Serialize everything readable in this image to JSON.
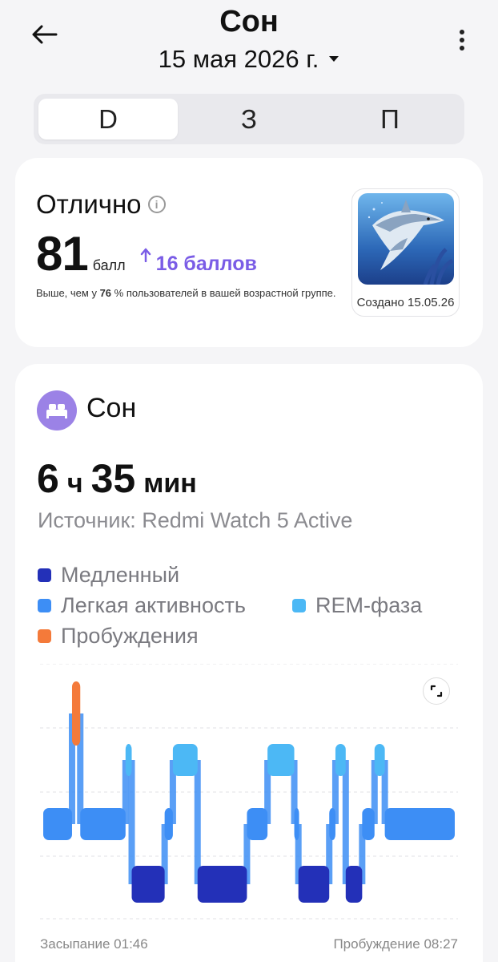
{
  "header": {
    "title": "Сон",
    "date": "15 мая 2026 г."
  },
  "tabs": [
    {
      "label": "D",
      "active": true
    },
    {
      "label": "З",
      "active": false
    },
    {
      "label": "П",
      "active": false
    }
  ],
  "score_card": {
    "rating": "Отлично",
    "score": "81",
    "score_unit": "балл",
    "delta": "16 баллов",
    "compare_prefix": "Выше, чем у ",
    "compare_value": "76",
    "compare_suffix": " % пользователей в вашей возрастной группе.",
    "badge_caption": "Создано 15.05.26"
  },
  "sleep": {
    "title": "Сон",
    "hours": "6",
    "hours_unit": "ч",
    "minutes": "35",
    "minutes_unit": "мин",
    "source": "Источник: Redmi Watch 5 Active",
    "legend": {
      "deep": "Медленный",
      "light": "Легкая активность",
      "rem": "REM-фаза",
      "awake": "Пробуждения"
    },
    "colors": {
      "deep": "#2330b8",
      "light": "#3d8ef5",
      "rem": "#4cb8f5",
      "awake": "#f47a3a"
    },
    "sleep_start_label": "Засыпание 01:46",
    "wake_label": "Пробуждение 08:27"
  },
  "chart_data": {
    "type": "timeline",
    "stages": [
      "awake",
      "rem",
      "light",
      "deep"
    ],
    "start": "01:46",
    "end": "08:27",
    "segments": [
      {
        "stage": "light",
        "from": 0.0,
        "to": 0.07
      },
      {
        "stage": "awake",
        "from": 0.07,
        "to": 0.09
      },
      {
        "stage": "light",
        "from": 0.09,
        "to": 0.2
      },
      {
        "stage": "rem",
        "from": 0.2,
        "to": 0.215
      },
      {
        "stage": "deep",
        "from": 0.215,
        "to": 0.295
      },
      {
        "stage": "light",
        "from": 0.295,
        "to": 0.315
      },
      {
        "stage": "rem",
        "from": 0.315,
        "to": 0.375
      },
      {
        "stage": "deep",
        "from": 0.375,
        "to": 0.495
      },
      {
        "stage": "light",
        "from": 0.495,
        "to": 0.545
      },
      {
        "stage": "rem",
        "from": 0.545,
        "to": 0.61
      },
      {
        "stage": "light",
        "from": 0.61,
        "to": 0.62
      },
      {
        "stage": "deep",
        "from": 0.62,
        "to": 0.695
      },
      {
        "stage": "light",
        "from": 0.695,
        "to": 0.71
      },
      {
        "stage": "rem",
        "from": 0.71,
        "to": 0.735
      },
      {
        "stage": "deep",
        "from": 0.735,
        "to": 0.775
      },
      {
        "stage": "light",
        "from": 0.775,
        "to": 0.805
      },
      {
        "stage": "rem",
        "from": 0.805,
        "to": 0.83
      },
      {
        "stage": "light",
        "from": 0.83,
        "to": 1.0
      }
    ]
  }
}
